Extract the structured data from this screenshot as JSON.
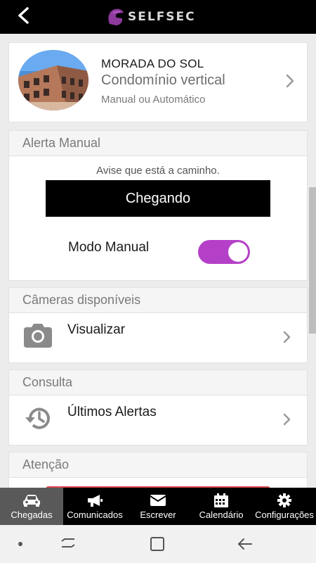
{
  "header": {
    "logo_text": "SELFSEC",
    "brand_color": "#8e3a9d"
  },
  "condo": {
    "name": "MORADA DO SOL",
    "type": "Condomínio vertical",
    "mode": "Manual ou Automático"
  },
  "alert_manual": {
    "title": "Alerta Manual",
    "hint": "Avise que está a caminho.",
    "button_label": "Chegando",
    "toggle_label": "Modo Manual",
    "toggle_on": true,
    "toggle_color": "#b540c8"
  },
  "cameras": {
    "title": "Câmeras disponíveis",
    "item_label": "Visualizar",
    "icon": "camera-icon"
  },
  "consulta": {
    "title": "Consulta",
    "item_label": "Últimos Alertas",
    "icon": "history-icon"
  },
  "atencao": {
    "title": "Atenção",
    "accent_color": "#d9464a"
  },
  "tabs": [
    {
      "label": "Chegadas",
      "icon": "car-icon",
      "active": true
    },
    {
      "label": "Comunicados",
      "icon": "megaphone-icon",
      "active": false
    },
    {
      "label": "Escrever",
      "icon": "envelope-icon",
      "active": false
    },
    {
      "label": "Calendário",
      "icon": "calendar-icon",
      "active": false
    },
    {
      "label": "Configurações",
      "icon": "gear-icon",
      "active": false
    }
  ]
}
